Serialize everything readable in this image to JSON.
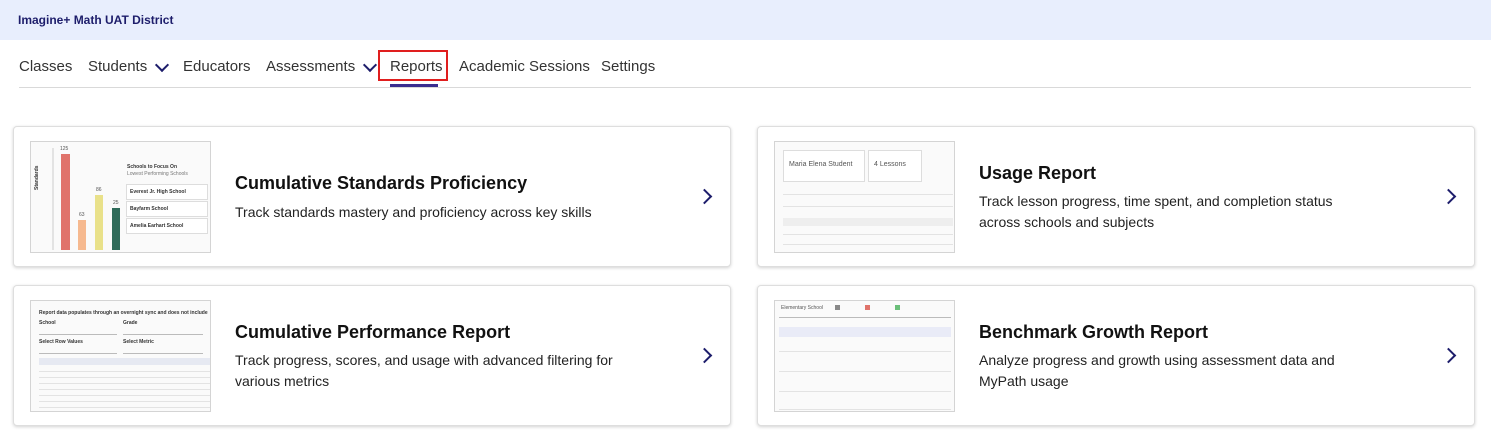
{
  "header": {
    "district": "Imagine+ Math UAT District"
  },
  "nav": {
    "tabs": [
      {
        "label": "Classes",
        "dropdown": false
      },
      {
        "label": "Students",
        "dropdown": true
      },
      {
        "label": "Educators",
        "dropdown": false
      },
      {
        "label": "Assessments",
        "dropdown": true
      },
      {
        "label": "Reports",
        "dropdown": false,
        "active": true
      },
      {
        "label": "Academic Sessions",
        "dropdown": false
      },
      {
        "label": "Settings",
        "dropdown": false
      }
    ]
  },
  "cards": [
    {
      "title": "Cumulative Standards Proficiency",
      "description": "Track standards mastery and proficiency across key skills"
    },
    {
      "title": "Usage Report",
      "description": "Track lesson progress, time spent, and completion status across schools and subjects"
    },
    {
      "title": "Cumulative Performance Report",
      "description": "Track progress, scores, and usage with advanced filtering for various metrics"
    },
    {
      "title": "Benchmark Growth Report",
      "description": "Analyze progress and growth using assessment data and MyPath usage"
    }
  ],
  "thumb_standards": {
    "axis_label": "Standards",
    "bar_values": [
      "125",
      "63",
      "86",
      "25"
    ],
    "panel_title": "Schools to Focus On",
    "panel_subtitle": "Lowest Performing Schools",
    "schools": [
      "Everest Jr. High School",
      "Bayfarm School",
      "Amelia Earhart School"
    ]
  },
  "thumb_usage": {
    "student": "Maria Elena Student",
    "lessons": "4 Lessons"
  },
  "thumb_performance": {
    "title": "Report data populates through an overnight sync and does not include",
    "school_label": "School",
    "grade_label": "Grade",
    "row_values_label": "Select Row Values",
    "metric_label": "Select Metric"
  },
  "thumb_benchmark": {
    "school": "Elementary School"
  },
  "colors": {
    "accent": "#1d1d6b",
    "highlight": "#e01e1e",
    "active_underline": "#3a2d8f"
  }
}
